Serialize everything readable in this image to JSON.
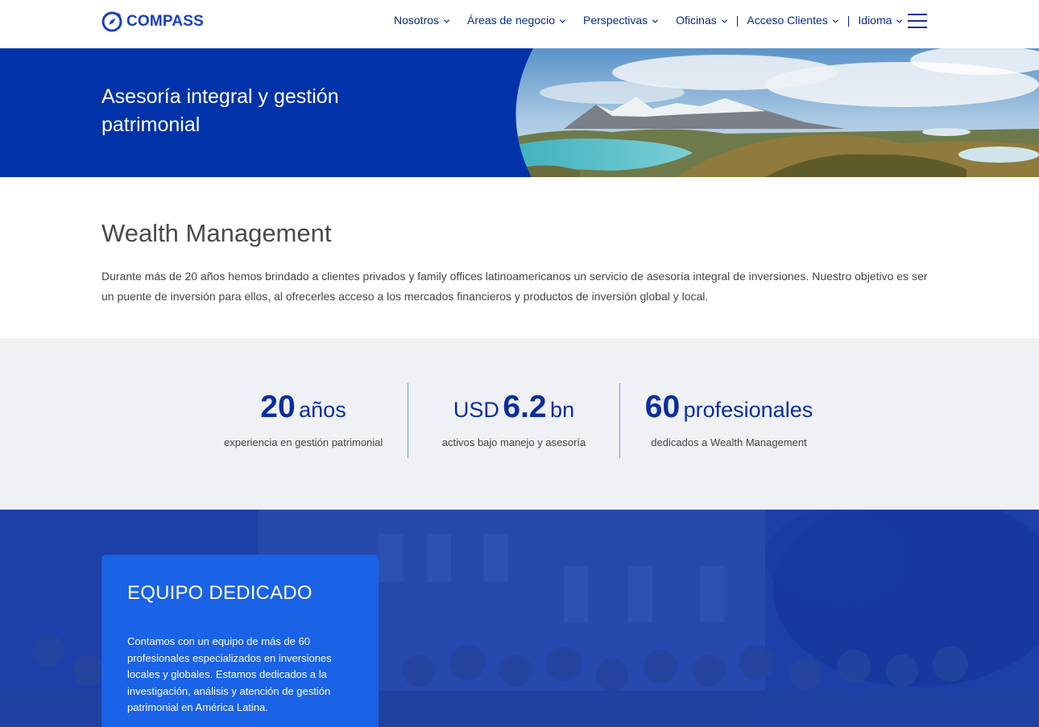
{
  "brand": {
    "name": "COMPASS",
    "primary": "#0033a9",
    "accent": "#1a62e6",
    "text": "#0a2a8c"
  },
  "nav": {
    "items": [
      {
        "label": "Nosotros",
        "icon": "chevron-down-icon"
      },
      {
        "label": "Áreas de negocio",
        "icon": "chevron-down-icon"
      },
      {
        "label": "Perspectivas",
        "icon": "chevron-down-icon"
      },
      {
        "label": "Oficinas",
        "icon": "chevron-down-icon"
      },
      {
        "label": "Acceso Clientes",
        "icon": "chevron-down-icon"
      },
      {
        "label": "Idioma",
        "icon": "chevron-down-icon"
      }
    ],
    "separator": "|",
    "menu_icon": "hamburger-menu-icon"
  },
  "hero": {
    "title": "Asesoría integral y gestión patrimonial"
  },
  "intro": {
    "heading": "Wealth Management",
    "body": "Durante más de 20 años hemos brindado a clientes privados y family offices latinoamericanos un servicio de asesoría integral de inversiones.  Nuestro objetivo es ser un puente de inversión para ellos, al ofrecerles acceso a los mercados financieros y productos de inversión global y local."
  },
  "stats": [
    {
      "prefix": "",
      "number": "20",
      "suffix": "años",
      "desc": "experiencia en gestión patrimonial"
    },
    {
      "prefix": "USD",
      "number": "6.2",
      "suffix": "bn",
      "desc": "activos bajo manejo y asesoría"
    },
    {
      "prefix": "",
      "number": "60",
      "suffix": "profesionales",
      "desc": "dedicados a Wealth Management"
    }
  ],
  "team": {
    "title": "EQUIPO DEDICADO",
    "body": "Contamos con un equipo de más de 60 profesionales especializados en inversiones locales y globales. Estamos dedicados a la investigación, análisis y atención de gestión patrimonial en América Latina."
  }
}
